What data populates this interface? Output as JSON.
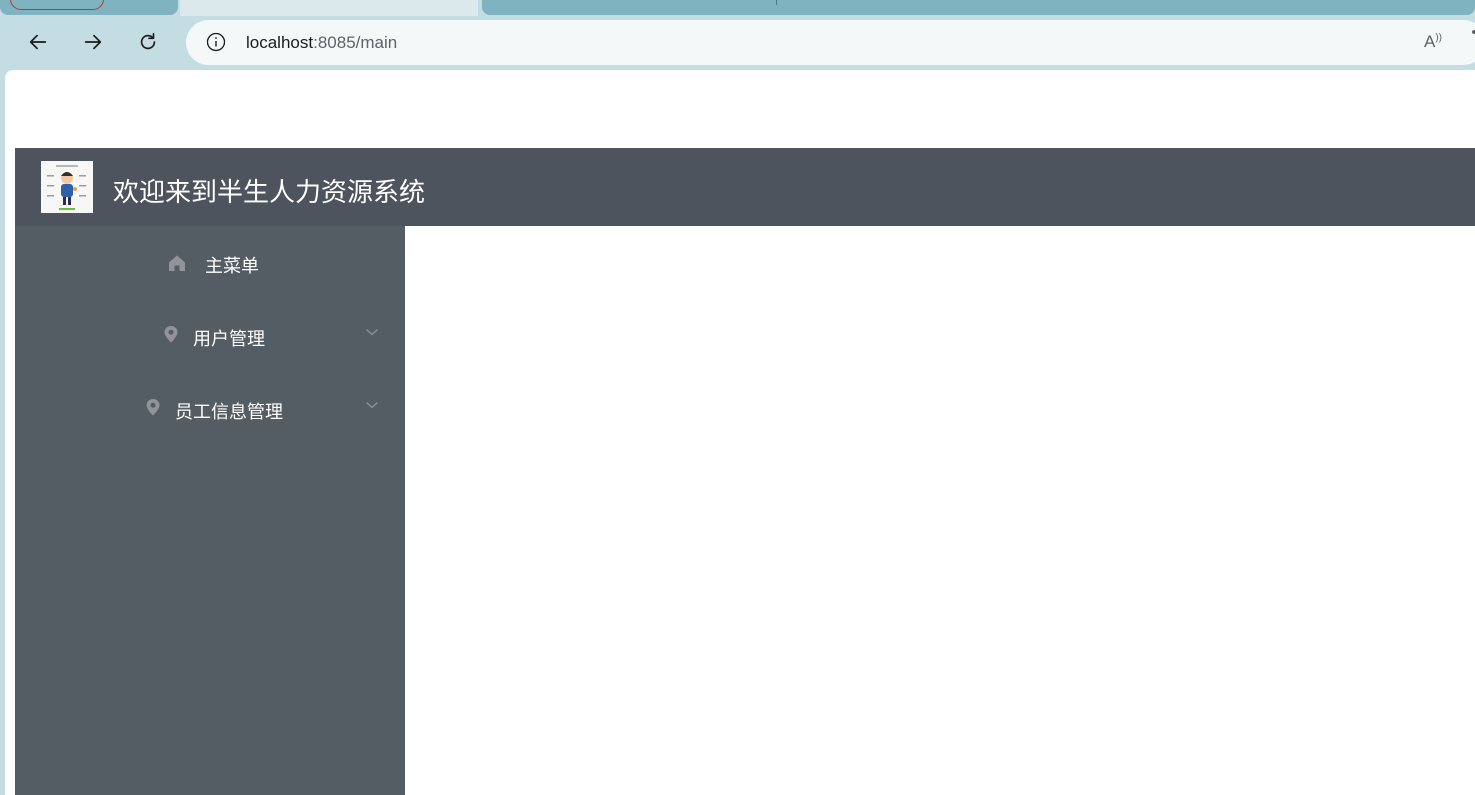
{
  "browser": {
    "url_host": "localhost",
    "url_rest": ":8085/main",
    "read_aloud_icon": "read-aloud-icon"
  },
  "app": {
    "title": "欢迎来到半生人力资源系统",
    "logo_icon": "cartoon-avatar-logo"
  },
  "sidebar": {
    "items": [
      {
        "label": "主菜单",
        "icon": "home-icon",
        "expandable": false
      },
      {
        "label": "用户管理",
        "icon": "location-pin-icon",
        "expandable": true
      },
      {
        "label": "员工信息管理",
        "icon": "location-pin-icon",
        "expandable": true
      }
    ]
  },
  "colors": {
    "header_bg": "#4d545d",
    "sidebar_bg": "#545c64",
    "sidebar_text": "#ffffff",
    "icon_color": "#909399",
    "browser_frame": "#c4dde2"
  }
}
